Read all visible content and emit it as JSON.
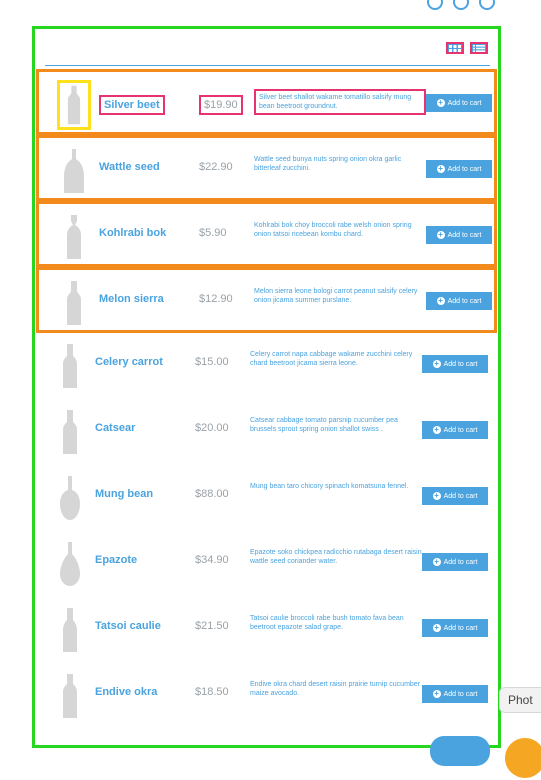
{
  "colors": {
    "accent": "#4aa3df",
    "price_muted": "#9aa2a8",
    "panel_outline": "#27d61f",
    "row_outline": "#f38b1c",
    "field_outline": "#e7336f",
    "thumb_outline": "#ffe11b",
    "button_outline": "#e12d2d"
  },
  "toolbar": {
    "grid_view_icon": "grid-view-icon",
    "list_view_icon": "list-view-icon"
  },
  "products": [
    {
      "name": "Silver beet",
      "price": "$19.90",
      "desc": "Silver beet shallot wakame tomatillo salsify mung bean beetroot groundnut.",
      "cart": "Add to cart"
    },
    {
      "name": "Wattle seed",
      "price": "$22.90",
      "desc": "Wattle seed bunya nuts spring onion okra garlic bitterleaf zucchini.",
      "cart": "Add to cart"
    },
    {
      "name": "Kohlrabi bok",
      "price": "$5.90",
      "desc": "Kohlrabi bok choy broccoli rabe welsh onion spring onion tatsoi ricebean kombu chard.",
      "cart": "Add to cart"
    },
    {
      "name": "Melon sierra",
      "price": "$12.90",
      "desc": "Melon sierra leone bologi carrot peanut salsify celery onion jicama summer purslane.",
      "cart": "Add to cart"
    },
    {
      "name": "Celery carrot",
      "price": "$15.00",
      "desc": "Celery carrot napa cabbage wakame zucchini celery chard beetroot jicama sierra leone.",
      "cart": "Add to cart"
    },
    {
      "name": "Catsear",
      "price": "$20.00",
      "desc": "Catsear cabbage tomato parsnip cucumber pea brussels sprout spring onion shallot swiss .",
      "cart": "Add to cart"
    },
    {
      "name": "Mung bean",
      "price": "$88.00",
      "desc": "Mung bean taro chicory spinach komatsuna fennel.",
      "cart": "Add to cart"
    },
    {
      "name": "Epazote",
      "price": "$34.90",
      "desc": "Epazote soko chickpea radicchio rutabaga desert raisin wattle seed coriander water.",
      "cart": "Add to cart"
    },
    {
      "name": "Tatsoi caulie",
      "price": "$21.50",
      "desc": "Tatsoi caulie broccoli rabe bush tomato fava bean beetroot epazote salad grape.",
      "cart": "Add to cart"
    },
    {
      "name": "Endive okra",
      "price": "$18.50",
      "desc": "Endive okra chard desert raisin prairie turnip cucumber maize avocado.",
      "cart": "Add to cart"
    }
  ],
  "tooltip": {
    "text": "Phot"
  }
}
